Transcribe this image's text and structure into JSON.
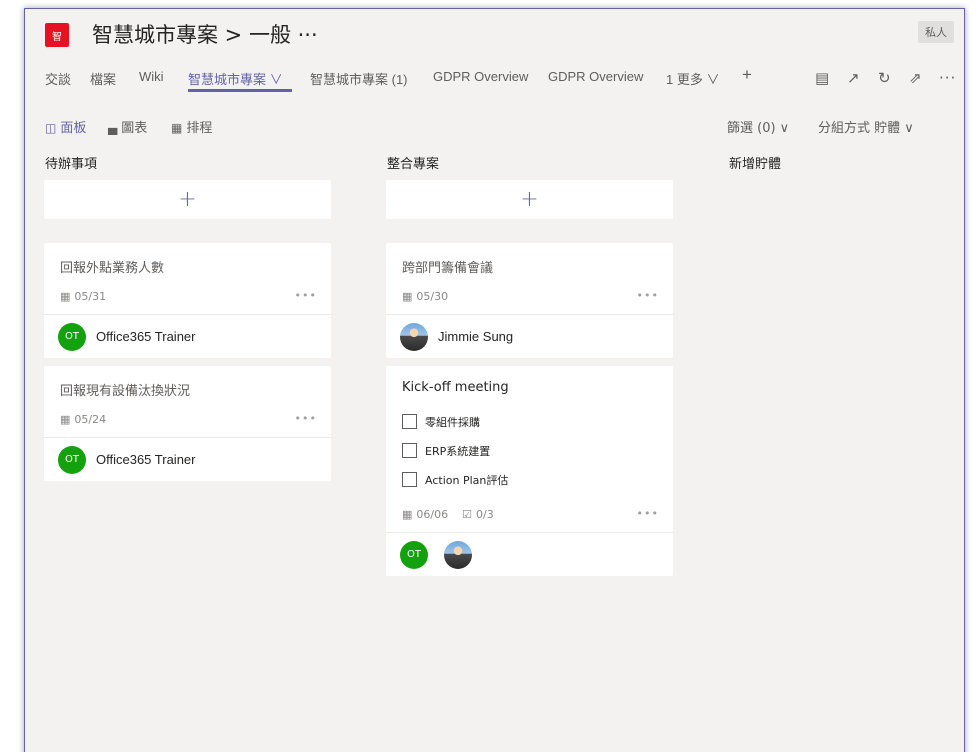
{
  "header": {
    "team_logo_text": "智",
    "channel_title": "智慧城市專案 > 一般 ···",
    "privacy": "私人"
  },
  "tabs": [
    {
      "label": "交談"
    },
    {
      "label": "檔案"
    },
    {
      "label": "Wiki"
    },
    {
      "label": "智慧城市專案 ∨"
    },
    {
      "label": "智慧城市專案 (1)"
    },
    {
      "label": "GDPR Overview"
    },
    {
      "label": "GDPR Overview"
    },
    {
      "label": "1 更多 ∨"
    },
    {
      "label": "+"
    }
  ],
  "tab_icons": [
    "chat-icon",
    "expand-icon",
    "refresh-icon",
    "popout-icon",
    "more-icon"
  ],
  "views": {
    "board": "面板",
    "charts": "圖表",
    "schedule": "排程",
    "filter": "篩選 (0) ∨",
    "group_by": "分組方式 貯體 ∨"
  },
  "columns": {
    "todo": {
      "title": "待辦事項",
      "tasks": [
        {
          "title": "回報外點業務人數",
          "due": "05/31",
          "assignee": "Office365 Trainer",
          "initials": "OT"
        },
        {
          "title": "回報現有設備汰換狀況",
          "due": "05/24",
          "assignee": "Office365 Trainer",
          "initials": "OT"
        }
      ]
    },
    "integration": {
      "title": "整合專案",
      "tasks": [
        {
          "title": "跨部門籌備會議",
          "due": "05/30",
          "assignee": "Jimmie Sung"
        },
        {
          "title": "Kick-off meeting",
          "checklist": [
            "零組件採購",
            "ERP系統建置",
            "Action Plan評估"
          ],
          "due": "06/06",
          "progress": "0/3",
          "initials": "OT"
        }
      ]
    },
    "new_bucket": {
      "title": "新增貯體"
    }
  },
  "colors": {
    "accent": "#6264a7",
    "team_logo": "#e81123",
    "avatar_green": "#13a10e"
  }
}
